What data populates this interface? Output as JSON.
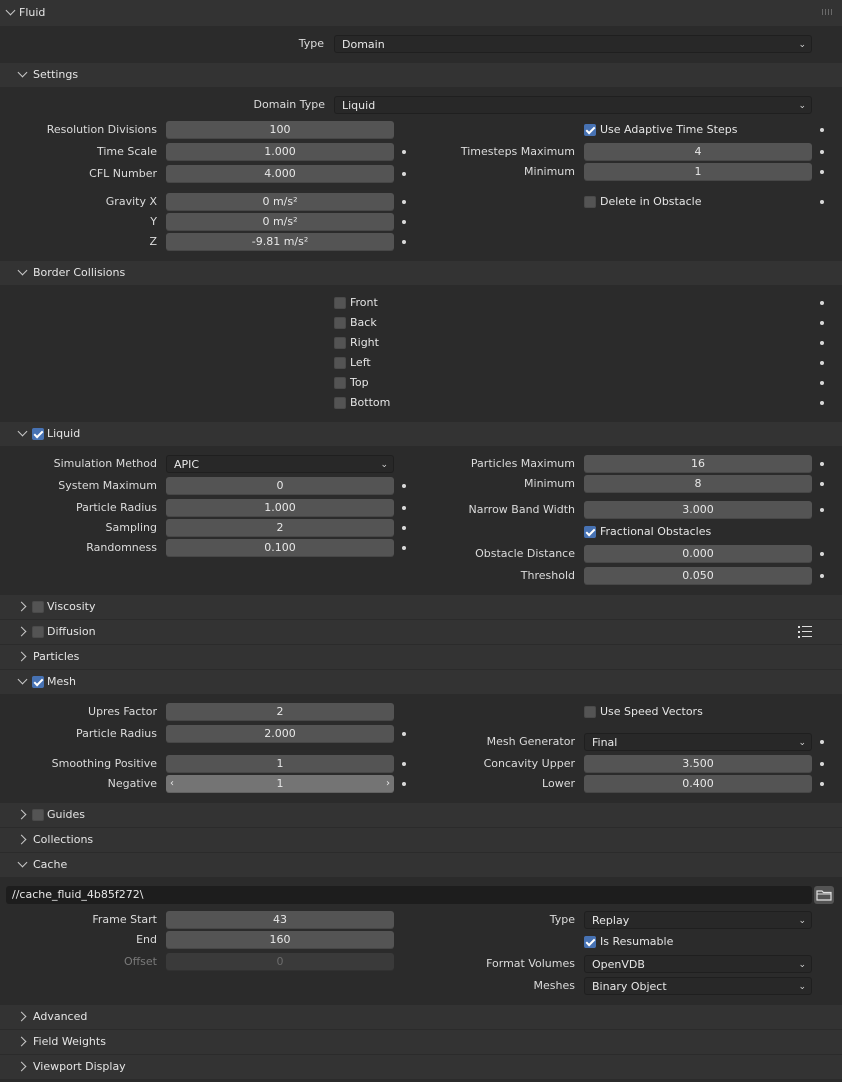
{
  "fluid": {
    "title": "Fluid",
    "type_label": "Type",
    "type_value": "Domain"
  },
  "settings": {
    "title": "Settings",
    "domain_type_label": "Domain Type",
    "domain_type_value": "Liquid",
    "resolution_label": "Resolution Divisions",
    "resolution_value": "100",
    "time_scale_label": "Time Scale",
    "time_scale_value": "1.000",
    "cfl_label": "CFL Number",
    "cfl_value": "4.000",
    "gravity_x_label": "Gravity X",
    "gravity_x_value": "0 m/s²",
    "gravity_y_label": "Y",
    "gravity_y_value": "0 m/s²",
    "gravity_z_label": "Z",
    "gravity_z_value": "-9.81 m/s²",
    "adaptive_label": "Use Adaptive Time Steps",
    "adaptive_checked": true,
    "timesteps_max_label": "Timesteps Maximum",
    "timesteps_max_value": "4",
    "timesteps_min_label": "Minimum",
    "timesteps_min_value": "1",
    "delete_obstacle_label": "Delete in Obstacle",
    "delete_obstacle_checked": false
  },
  "border": {
    "title": "Border Collisions",
    "items": [
      {
        "label": "Front",
        "checked": false
      },
      {
        "label": "Back",
        "checked": false
      },
      {
        "label": "Right",
        "checked": false
      },
      {
        "label": "Left",
        "checked": false
      },
      {
        "label": "Top",
        "checked": false
      },
      {
        "label": "Bottom",
        "checked": false
      }
    ]
  },
  "liquid": {
    "title": "Liquid",
    "enabled": true,
    "sim_method_label": "Simulation Method",
    "sim_method_value": "APIC",
    "system_max_label": "System Maximum",
    "system_max_value": "0",
    "particle_radius_label": "Particle Radius",
    "particle_radius_value": "1.000",
    "sampling_label": "Sampling",
    "sampling_value": "2",
    "randomness_label": "Randomness",
    "randomness_value": "0.100",
    "particles_max_label": "Particles Maximum",
    "particles_max_value": "16",
    "particles_min_label": "Minimum",
    "particles_min_value": "8",
    "narrow_band_label": "Narrow Band Width",
    "narrow_band_value": "3.000",
    "fractional_label": "Fractional Obstacles",
    "fractional_checked": true,
    "obstacle_distance_label": "Obstacle Distance",
    "obstacle_distance_value": "0.000",
    "threshold_label": "Threshold",
    "threshold_value": "0.050"
  },
  "viscosity": {
    "title": "Viscosity",
    "enabled": false
  },
  "diffusion": {
    "title": "Diffusion",
    "enabled": false
  },
  "particles": {
    "title": "Particles"
  },
  "mesh": {
    "title": "Mesh",
    "enabled": true,
    "upres_label": "Upres Factor",
    "upres_value": "2",
    "particle_radius_label": "Particle Radius",
    "particle_radius_value": "2.000",
    "smoothing_pos_label": "Smoothing Positive",
    "smoothing_pos_value": "1",
    "smoothing_neg_label": "Negative",
    "smoothing_neg_value": "1",
    "speed_vectors_label": "Use Speed Vectors",
    "speed_vectors_checked": false,
    "generator_label": "Mesh Generator",
    "generator_value": "Final",
    "concavity_upper_label": "Concavity Upper",
    "concavity_upper_value": "3.500",
    "concavity_lower_label": "Lower",
    "concavity_lower_value": "0.400"
  },
  "guides": {
    "title": "Guides",
    "enabled": false
  },
  "collections": {
    "title": "Collections"
  },
  "cache": {
    "title": "Cache",
    "path": "//cache_fluid_4b85f272\\",
    "frame_start_label": "Frame Start",
    "frame_start_value": "43",
    "end_label": "End",
    "end_value": "160",
    "offset_label": "Offset",
    "offset_value": "0",
    "type_label": "Type",
    "type_value": "Replay",
    "resumable_label": "Is Resumable",
    "resumable_checked": true,
    "format_volumes_label": "Format Volumes",
    "format_volumes_value": "OpenVDB",
    "meshes_label": "Meshes",
    "meshes_value": "Binary Object"
  },
  "advanced": {
    "title": "Advanced"
  },
  "field_weights": {
    "title": "Field Weights"
  },
  "viewport_display": {
    "title": "Viewport Display"
  },
  "colors": {
    "accent": "#4772b3",
    "field": "#545454",
    "panel": "#2b2b2b",
    "header": "#333333"
  }
}
